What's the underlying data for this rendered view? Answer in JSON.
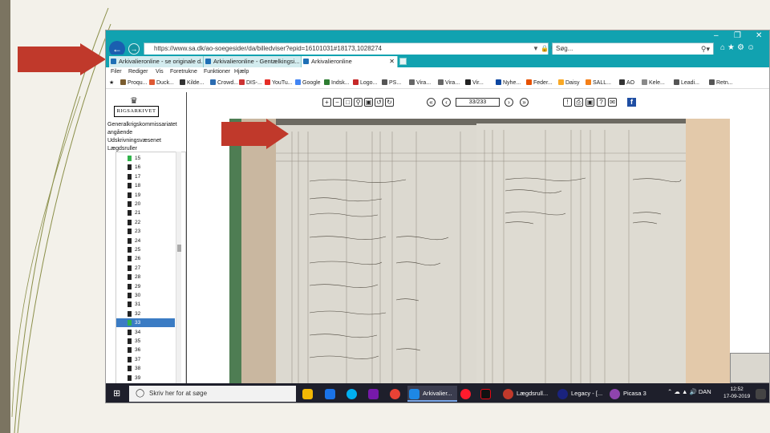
{
  "browser": {
    "url": "https://www.sa.dk/ao-soegesider/da/billedviser?epid=16101031#18173,1028274",
    "search_placeholder": "Søg...",
    "tabs": [
      {
        "label": "Arkivalieronline - se originale d..."
      },
      {
        "label": "Arkivalieronline - Gentælkingsi..."
      },
      {
        "label": "Arkivalieronline"
      }
    ],
    "menu": [
      "Filer",
      "Rediger",
      "Vis",
      "Foretrukne",
      "Funktioner",
      "Hjælp"
    ],
    "favorites": [
      "Proqu...",
      "Duck...",
      "Kilde...",
      "Crowd...",
      "DIS-...",
      "YouTu...",
      "Google",
      "Indsk...",
      "Logo...",
      "PS...",
      "Vira...",
      "Vira...",
      "Vir...",
      "Nyhe...",
      "Feder...",
      "Daisy",
      "SALL...",
      "AO",
      "Kele...",
      "Leadi...",
      "Retn..."
    ]
  },
  "viewer": {
    "logo": "RIGSARKIVET",
    "breadcrumb": [
      "Generalkrigskommissariatet",
      "angående",
      "Udskrivningsvæsenet",
      "Lægdsruller"
    ],
    "tree": [
      "15",
      "16",
      "17",
      "18",
      "19",
      "20",
      "21",
      "22",
      "23",
      "24",
      "25",
      "26",
      "27",
      "28",
      "29",
      "30",
      "31",
      "32",
      "33",
      "34",
      "35",
      "36",
      "37",
      "38",
      "39"
    ],
    "selected_item": "33",
    "page_indicator": "33/233"
  },
  "taskbar": {
    "search_placeholder": "Skriv her for at søge",
    "apps": [
      "Arkivalier...",
      "Lægdsrull...",
      "Legacy - [...",
      "Picasa 3"
    ],
    "language": "DAN",
    "time": "12:52",
    "date": "17-09-2019"
  },
  "colors": {
    "browser_chrome": "#11a2b0",
    "taskbar": "#1e1f2b",
    "selection": "#3b7cc4",
    "arrow": "#c0392b"
  }
}
